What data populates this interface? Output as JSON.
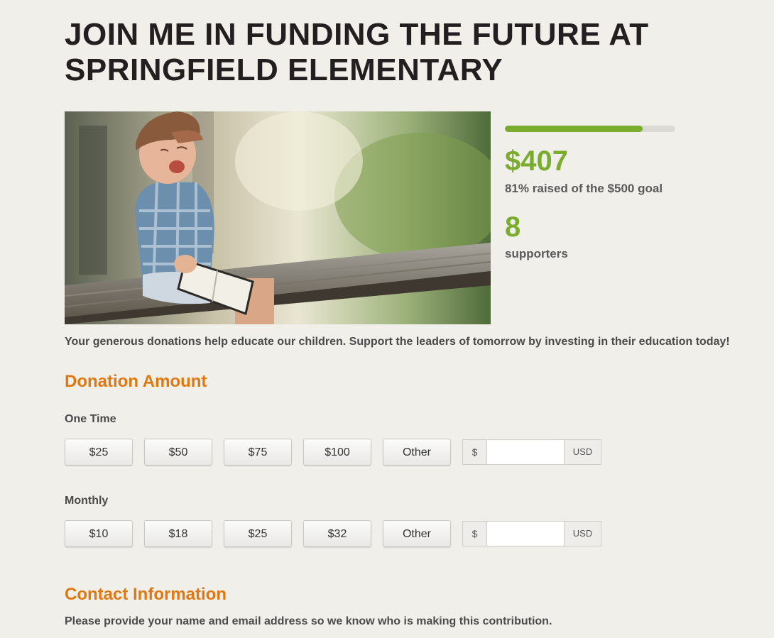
{
  "campaign": {
    "title_line1": "JOIN ME IN FUNDING THE FUTURE AT",
    "title_line2": "SPRINGFIELD ELEMENTARY",
    "image_alt": "Laughing boy in plaid shirt and cap sitting on a wooden bench holding an open book",
    "description": "Your generous donations help educate our children. Support the leaders of tomorrow by investing in their education today!"
  },
  "progress": {
    "raised_amount": "$407",
    "raised_note": "81% raised of the $500 goal",
    "percent": 81,
    "supporters_count": "8",
    "supporters_label": "supporters",
    "accent_color": "#7aad2f"
  },
  "donation": {
    "heading": "Donation Amount",
    "one_time": {
      "label": "One Time",
      "options": [
        "$25",
        "$50",
        "$75",
        "$100",
        "Other"
      ],
      "currency_symbol": "$",
      "currency_code": "USD",
      "custom_value": ""
    },
    "monthly": {
      "label": "Monthly",
      "options": [
        "$10",
        "$18",
        "$25",
        "$32",
        "Other"
      ],
      "currency_symbol": "$",
      "currency_code": "USD",
      "custom_value": ""
    },
    "heading_color": "#e0780f"
  },
  "contact": {
    "heading": "Contact Information",
    "note": "Please provide your name and email address so we know who is making this contribution."
  }
}
